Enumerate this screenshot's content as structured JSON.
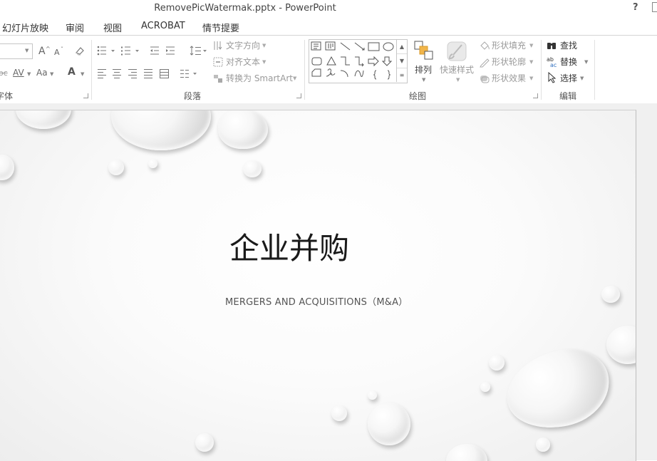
{
  "window": {
    "title": "RemovePicWatermak.pptx - PowerPoint",
    "help": "?"
  },
  "tabs": [
    "幻灯片放映",
    "审阅",
    "视图",
    "ACROBAT",
    "情节提要"
  ],
  "ribbon": {
    "font": {
      "label": "字体",
      "grow_font": "A",
      "shrink_font": "A",
      "char_spacing": "AV",
      "change_case": "Aa",
      "font_color": "A",
      "strike_fragment": "abc"
    },
    "paragraph": {
      "label": "段落",
      "text_direction": "文字方向",
      "align_text": "对齐文本",
      "convert_smartart": "转换为 SmartArt"
    },
    "drawing": {
      "label": "绘图",
      "arrange": "排列",
      "quick_styles": "快速样式",
      "shape_fill": "形状填充",
      "shape_outline": "形状轮廓",
      "shape_effects": "形状效果"
    },
    "editing": {
      "label": "编辑",
      "find": "查找",
      "replace": "替换",
      "select": "选择"
    }
  },
  "slide": {
    "title": "企业并购",
    "subtitle": "MERGERS AND ACQUISITIONS（M&A）"
  }
}
